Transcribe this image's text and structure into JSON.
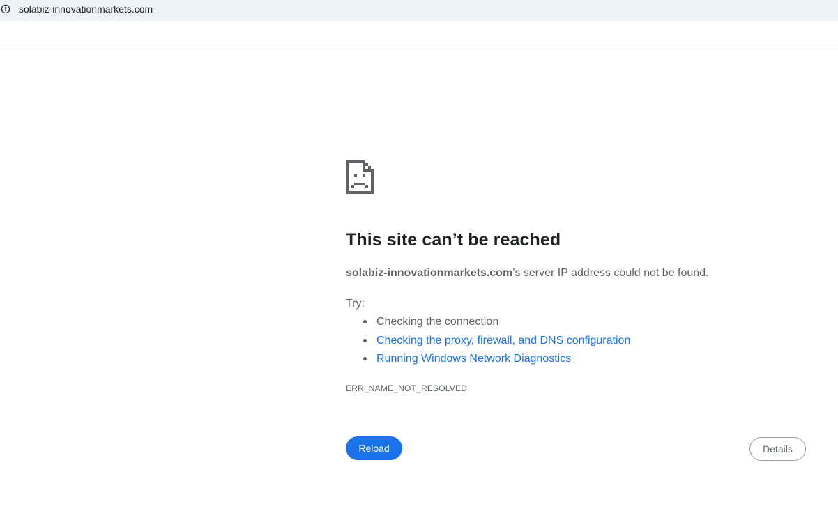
{
  "address_bar": {
    "icon": "info-icon",
    "url": "solabiz-innovationmarkets.com"
  },
  "error": {
    "icon": "sad-page-icon",
    "heading": "This site can’t be reached",
    "summary_host": "solabiz-innovationmarkets.com",
    "summary_rest": "’s server IP address could not be found.",
    "try_label": "Try:",
    "suggestions": [
      {
        "label": "Checking the connection",
        "is_link": false
      },
      {
        "label": "Checking the proxy, firewall, and DNS configuration",
        "is_link": true
      },
      {
        "label": "Running Windows Network Diagnostics",
        "is_link": true
      }
    ],
    "code": "ERR_NAME_NOT_RESOLVED"
  },
  "buttons": {
    "reload_label": "Reload",
    "details_label": "Details"
  },
  "colors": {
    "address_bar_bg": "#eef2f9",
    "link": "#1a73e8",
    "primary_button": "#1a73e8",
    "secondary_text": "#5f6368",
    "heading_text": "#202124"
  }
}
